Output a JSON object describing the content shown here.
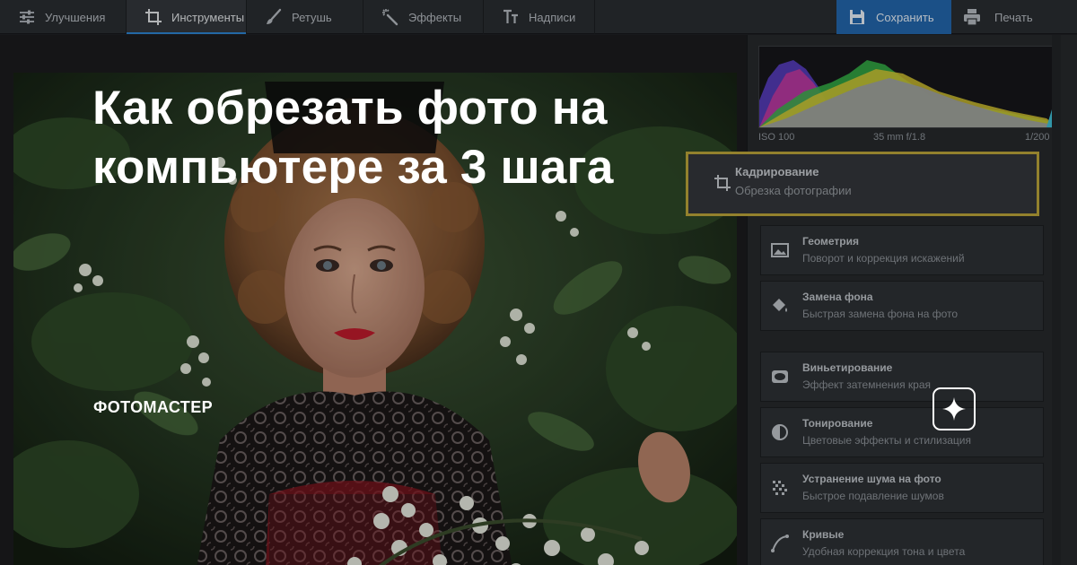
{
  "toolbar": {
    "tabs": [
      {
        "label": "Улучшения",
        "icon": "sliders-icon"
      },
      {
        "label": "Инструменты",
        "icon": "crop-icon"
      },
      {
        "label": "Ретушь",
        "icon": "brush-icon"
      },
      {
        "label": "Эффекты",
        "icon": "magic-wand-icon"
      },
      {
        "label": "Надписи",
        "icon": "text-icon"
      }
    ],
    "active_tab": "Инструменты",
    "save_label": "Сохранить",
    "print_label": "Печать"
  },
  "histogram": {
    "iso": "ISO 100",
    "lens": "35 mm f/1.8",
    "shutter": "1/200"
  },
  "tools": [
    {
      "title": "Кадрирование",
      "subtitle": "Обрезка фотографии",
      "icon": "crop-icon",
      "highlighted": true
    },
    {
      "title": "Геометрия",
      "subtitle": "Поворот и коррекция искажений",
      "icon": "image-frame-icon"
    },
    {
      "title": "Замена фона",
      "subtitle": "Быстрая замена фона на фото",
      "icon": "paint-bucket-icon"
    },
    {
      "title": "Виньетирование",
      "subtitle": "Эффект затемнения края",
      "icon": "vignette-icon"
    },
    {
      "title": "Тонирование",
      "subtitle": "Цветовые эффекты и стилизация",
      "icon": "half-circle-icon"
    },
    {
      "title": "Устранение шума на фото",
      "subtitle": "Быстрое подавление шумов",
      "icon": "noise-icon"
    },
    {
      "title": "Кривые",
      "subtitle": "Удобная коррекция тона и цвета",
      "icon": "curve-icon"
    }
  ],
  "overlay": {
    "headline_line1": "Как обрезать фото на",
    "headline_line2": "компьютере за 3 шага",
    "brand": "ФОТОМАСТЕР"
  },
  "colors": {
    "accent": "#2367ad",
    "highlight_border": "#bda63a",
    "panel_bg": "#27292c"
  }
}
